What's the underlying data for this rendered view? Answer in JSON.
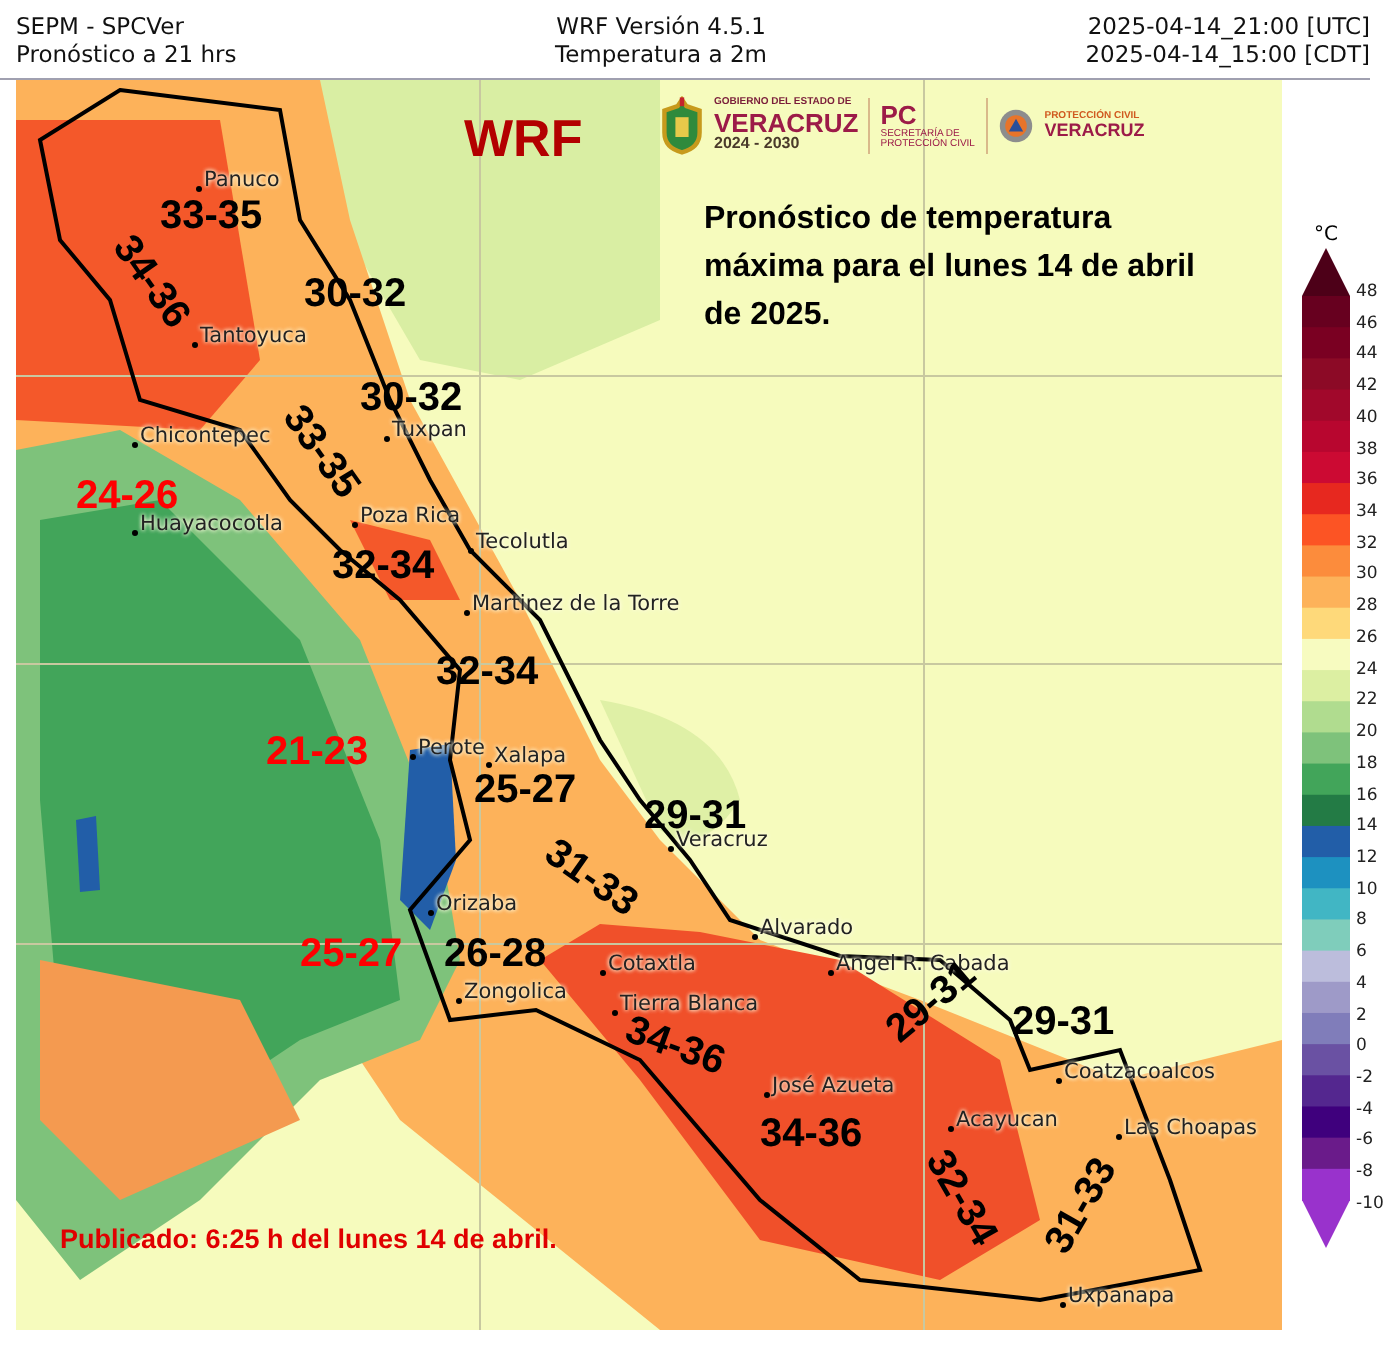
{
  "header": {
    "left": [
      "SEPM - SPCVer",
      "Pronóstico a 21 hrs"
    ],
    "center": [
      "WRF Versión 4.5.1",
      "Temperatura a 2m"
    ],
    "right": [
      "2025-04-14_21:00 [UTC]",
      "2025-04-14_15:00 [CDT]"
    ]
  },
  "title": "WRF",
  "logos": {
    "state": [
      "GOBIERNO DEL ESTADO DE",
      "VERACRUZ",
      "2024 - 2030"
    ],
    "pc": [
      "PC",
      "SECRETARÍA DE PROTECCIÓN CIVIL"
    ],
    "pcv": [
      "PROTECCIÓN CIVIL",
      "VERACRUZ"
    ]
  },
  "description": "Pronóstico de temperatura máxima para el lunes 14 de abril de 2025.",
  "cities": [
    "Panuco",
    "Tantoyuca",
    "Chicontepec",
    "Tuxpan",
    "Huayacocotla",
    "Poza Rica",
    "Tecolutla",
    "Martinez de la Torre",
    "Perote",
    "Xalapa",
    "Veracruz",
    "Orizaba",
    "Cotaxtla",
    "Zongolica",
    "Alvarado",
    "Angel R. Cabada",
    "Tierra Blanca",
    "José Azueta",
    "Acayucan",
    "Coatzacoalcos",
    "Las Choapas",
    "Uxpanapa"
  ],
  "ranges": [
    {
      "text": "33-35",
      "color": "#000000"
    },
    {
      "text": "34-36",
      "color": "#000000"
    },
    {
      "text": "30-32",
      "color": "#000000"
    },
    {
      "text": "30-32",
      "color": "#000000"
    },
    {
      "text": "33-35",
      "color": "#000000"
    },
    {
      "text": "24-26",
      "color": "#ff0000"
    },
    {
      "text": "32-34",
      "color": "#000000"
    },
    {
      "text": "32-34",
      "color": "#000000"
    },
    {
      "text": "21-23",
      "color": "#ff0000"
    },
    {
      "text": "25-27",
      "color": "#000000"
    },
    {
      "text": "29-31",
      "color": "#000000"
    },
    {
      "text": "31-33",
      "color": "#000000"
    },
    {
      "text": "26-28",
      "color": "#000000"
    },
    {
      "text": "25-27",
      "color": "#ff0000"
    },
    {
      "text": "34-36",
      "color": "#000000"
    },
    {
      "text": "34-36",
      "color": "#000000"
    },
    {
      "text": "29-31",
      "color": "#000000"
    },
    {
      "text": "29-31",
      "color": "#000000"
    },
    {
      "text": "32-34",
      "color": "#000000"
    },
    {
      "text": "31-33",
      "color": "#000000"
    }
  ],
  "footer": "Publicado: 6:25 h del lunes 14 de abril.",
  "colorbar": {
    "unit": "°C",
    "ticks": [
      "48",
      "46",
      "44",
      "42",
      "40",
      "38",
      "36",
      "34",
      "32",
      "30",
      "28",
      "26",
      "24",
      "22",
      "20",
      "18",
      "16",
      "14",
      "12",
      "10",
      "8",
      "6",
      "4",
      "2",
      "0",
      "-2",
      "-4",
      "-6",
      "-8",
      "-10"
    ],
    "bins": [
      {
        "kind": "top",
        "color": "#4d0018"
      },
      {
        "kind": "bin",
        "color": "#67001f"
      },
      {
        "kind": "bin",
        "color": "#7a0022"
      },
      {
        "kind": "bin",
        "color": "#8c0a26"
      },
      {
        "kind": "bin",
        "color": "#a1082b"
      },
      {
        "kind": "bin",
        "color": "#b8062f"
      },
      {
        "kind": "bin",
        "color": "#cc0a33"
      },
      {
        "kind": "bin",
        "color": "#e7281f"
      },
      {
        "kind": "bin",
        "color": "#fc5424"
      },
      {
        "kind": "bin",
        "color": "#fc8c3c"
      },
      {
        "kind": "bin",
        "color": "#fdb25a"
      },
      {
        "kind": "bin",
        "color": "#fed97a"
      },
      {
        "kind": "bin",
        "color": "#f7fbc0"
      },
      {
        "kind": "bin",
        "color": "#dcefa2"
      },
      {
        "kind": "bin",
        "color": "#b0dc8f"
      },
      {
        "kind": "bin",
        "color": "#7ec27b"
      },
      {
        "kind": "bin",
        "color": "#42a55a"
      },
      {
        "kind": "bin",
        "color": "#237b45"
      },
      {
        "kind": "bin",
        "color": "#225ea8"
      },
      {
        "kind": "bin",
        "color": "#1d91c0"
      },
      {
        "kind": "bin",
        "color": "#41b6c4"
      },
      {
        "kind": "bin",
        "color": "#7fcdbb"
      },
      {
        "kind": "bin",
        "color": "#bcbddc"
      },
      {
        "kind": "bin",
        "color": "#9e9ac8"
      },
      {
        "kind": "bin",
        "color": "#807dba"
      },
      {
        "kind": "bin",
        "color": "#6a51a3"
      },
      {
        "kind": "bin",
        "color": "#54278f"
      },
      {
        "kind": "bin",
        "color": "#3f007d"
      },
      {
        "kind": "bin",
        "color": "#6a1b8a"
      },
      {
        "kind": "bin",
        "color": "#9932cc"
      },
      {
        "kind": "bottom",
        "color": "#9932cc"
      }
    ]
  }
}
